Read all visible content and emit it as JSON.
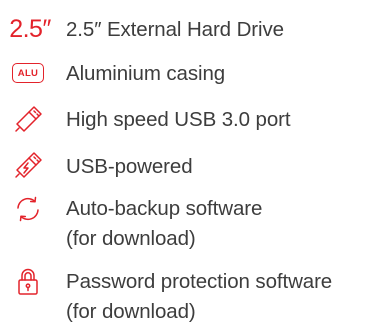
{
  "features": [
    {
      "icon": "size-2-5-inch-mark",
      "mark": "2.5″",
      "label": "2.5″ External Hard Drive"
    },
    {
      "icon": "alu-badge-icon",
      "badge": "ALU",
      "label": "Aluminium casing"
    },
    {
      "icon": "usb-stick-icon",
      "label": "High speed USB 3.0 port"
    },
    {
      "icon": "usb-power-icon",
      "label": "USB-powered"
    },
    {
      "icon": "sync-arrows-icon",
      "label": "Auto-backup software\n(for download)"
    },
    {
      "icon": "padlock-icon",
      "label": "Password protection software\n(for download)"
    }
  ],
  "colors": {
    "accent": "#e3232b",
    "text": "#3d3d3d",
    "background": "#ffffff"
  }
}
